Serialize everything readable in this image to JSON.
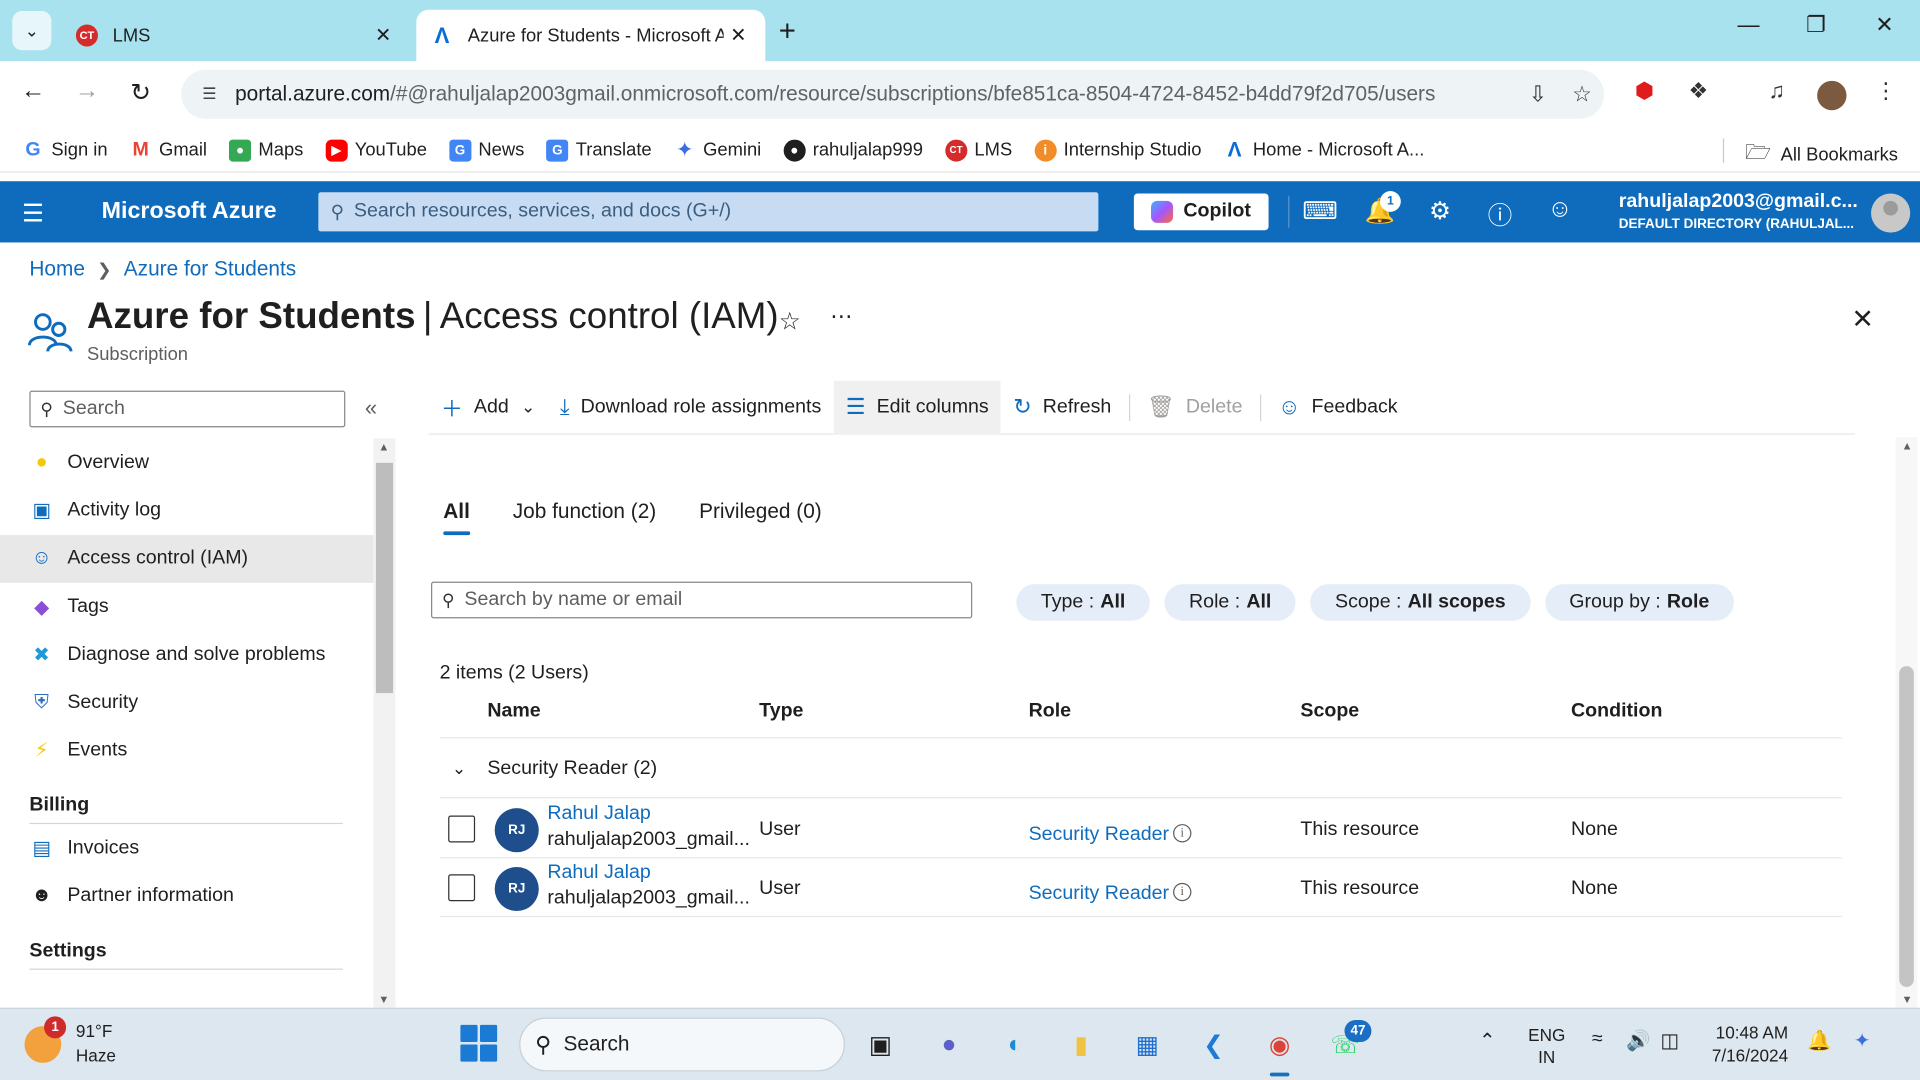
{
  "browser": {
    "tabs": [
      {
        "label": "LMS",
        "icon": "lms-icon"
      },
      {
        "label": "Azure for Students - Microsoft Azure",
        "icon": "azure-icon"
      }
    ],
    "url_host": "portal.azure.com",
    "url_path": "/#@rahuljalap2003gmail.onmicrosoft.com/resource/subscriptions/bfe851ca-8504-4724-8452-b4dd79f2d705/users",
    "bookmarks": [
      {
        "label": "Sign in",
        "icon": "google-icon",
        "color": "#4285f4"
      },
      {
        "label": "Gmail",
        "icon": "gmail-icon",
        "color": "#ea4335"
      },
      {
        "label": "Maps",
        "icon": "maps-icon",
        "color": "#34a853"
      },
      {
        "label": "YouTube",
        "icon": "youtube-icon",
        "color": "#ff0000"
      },
      {
        "label": "News",
        "icon": "news-icon",
        "color": "#4285f4"
      },
      {
        "label": "Translate",
        "icon": "translate-icon",
        "color": "#4285f4"
      },
      {
        "label": "Gemini",
        "icon": "gemini-icon",
        "color": "#3b6fe0"
      },
      {
        "label": "rahuljalap999",
        "icon": "github-icon",
        "color": "#1f1f1f"
      },
      {
        "label": "LMS",
        "icon": "lms-icon",
        "color": "#d62b2b"
      },
      {
        "label": "Internship Studio",
        "icon": "internship-studio-icon",
        "color": "#f28c28"
      },
      {
        "label": "Home - Microsoft A...",
        "icon": "azure-icon",
        "color": "#0a6cd6"
      }
    ],
    "all_bookmarks": "All Bookmarks"
  },
  "azure": {
    "brand": "Microsoft Azure",
    "search_placeholder": "Search resources, services, and docs (G+/)",
    "copilot": "Copilot",
    "notification_count": "1",
    "account_email": "rahuljalap2003@gmail.c...",
    "account_directory": "DEFAULT DIRECTORY (RAHULJAL..."
  },
  "breadcrumb": [
    "Home",
    "Azure for Students"
  ],
  "page": {
    "title_strong": "Azure for Students",
    "title_rest": "Access control (IAM)",
    "subtitle": "Subscription"
  },
  "sidebar": {
    "search_placeholder": "Search",
    "items": [
      {
        "label": "Overview",
        "icon": "key-icon",
        "color": "#f2c811"
      },
      {
        "label": "Activity log",
        "icon": "activity-log-icon",
        "color": "#0f6cbd"
      },
      {
        "label": "Access control (IAM)",
        "icon": "people-icon",
        "color": "#0f6cbd",
        "selected": true
      },
      {
        "label": "Tags",
        "icon": "tag-icon",
        "color": "#8a4fd6"
      },
      {
        "label": "Diagnose and solve problems",
        "icon": "wrench-icon",
        "color": "#1f9ad6"
      },
      {
        "label": "Security",
        "icon": "shield-icon",
        "color": "#2b6cc4"
      },
      {
        "label": "Events",
        "icon": "lightning-icon",
        "color": "#f2c811"
      }
    ],
    "billing_group": "Billing",
    "billing_items": [
      {
        "label": "Invoices",
        "icon": "invoice-icon",
        "color": "#0f6cbd"
      },
      {
        "label": "Partner information",
        "icon": "partner-icon",
        "color": "#1f1f1f"
      }
    ],
    "settings_group": "Settings"
  },
  "commands": {
    "add": "Add",
    "download": "Download role assignments",
    "edit_columns": "Edit columns",
    "refresh": "Refresh",
    "delete": "Delete",
    "feedback": "Feedback"
  },
  "pivots": [
    {
      "label": "All",
      "active": true
    },
    {
      "label": "Job function (2)",
      "active": false
    },
    {
      "label": "Privileged (0)",
      "active": false
    }
  ],
  "list": {
    "search_placeholder": "Search by name or email",
    "filters": [
      {
        "label": "Type :",
        "value": "All"
      },
      {
        "label": "Role :",
        "value": "All"
      },
      {
        "label": "Scope :",
        "value": "All scopes"
      },
      {
        "label": "Group by :",
        "value": "Role"
      }
    ],
    "count": "2 items (2 Users)",
    "columns": [
      "Name",
      "Type",
      "Role",
      "Scope",
      "Condition"
    ],
    "group_label": "Security Reader (2)",
    "rows": [
      {
        "initials": "RJ",
        "name": "Rahul Jalap",
        "email": "rahuljalap2003_gmail...",
        "type": "User",
        "role": "Security Reader",
        "scope": "This resource",
        "condition": "None"
      },
      {
        "initials": "RJ",
        "name": "Rahul Jalap",
        "email": "rahuljalap2003_gmail...",
        "type": "User",
        "role": "Security Reader",
        "scope": "This resource",
        "condition": "None"
      }
    ]
  },
  "taskbar": {
    "weather_temp": "91°F",
    "weather_desc": "Haze",
    "weather_badge": "1",
    "search_placeholder": "Search",
    "whatsapp_badge": "47",
    "lang_1": "ENG",
    "lang_2": "IN",
    "time": "10:48 AM",
    "date": "7/16/2024"
  }
}
